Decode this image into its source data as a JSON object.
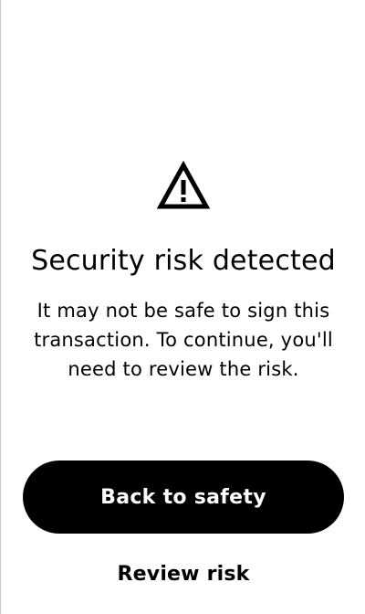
{
  "alert": {
    "icon": "warning-triangle-icon",
    "title": "Security risk detected",
    "message": "It may not be safe to sign this transaction. To continue, you'll need to review the risk."
  },
  "actions": {
    "primary_label": "Back to safety",
    "secondary_label": "Review risk"
  },
  "colors": {
    "background": "#ffffff",
    "primary_button": "#000000",
    "primary_button_text": "#ffffff",
    "text": "#000000"
  }
}
